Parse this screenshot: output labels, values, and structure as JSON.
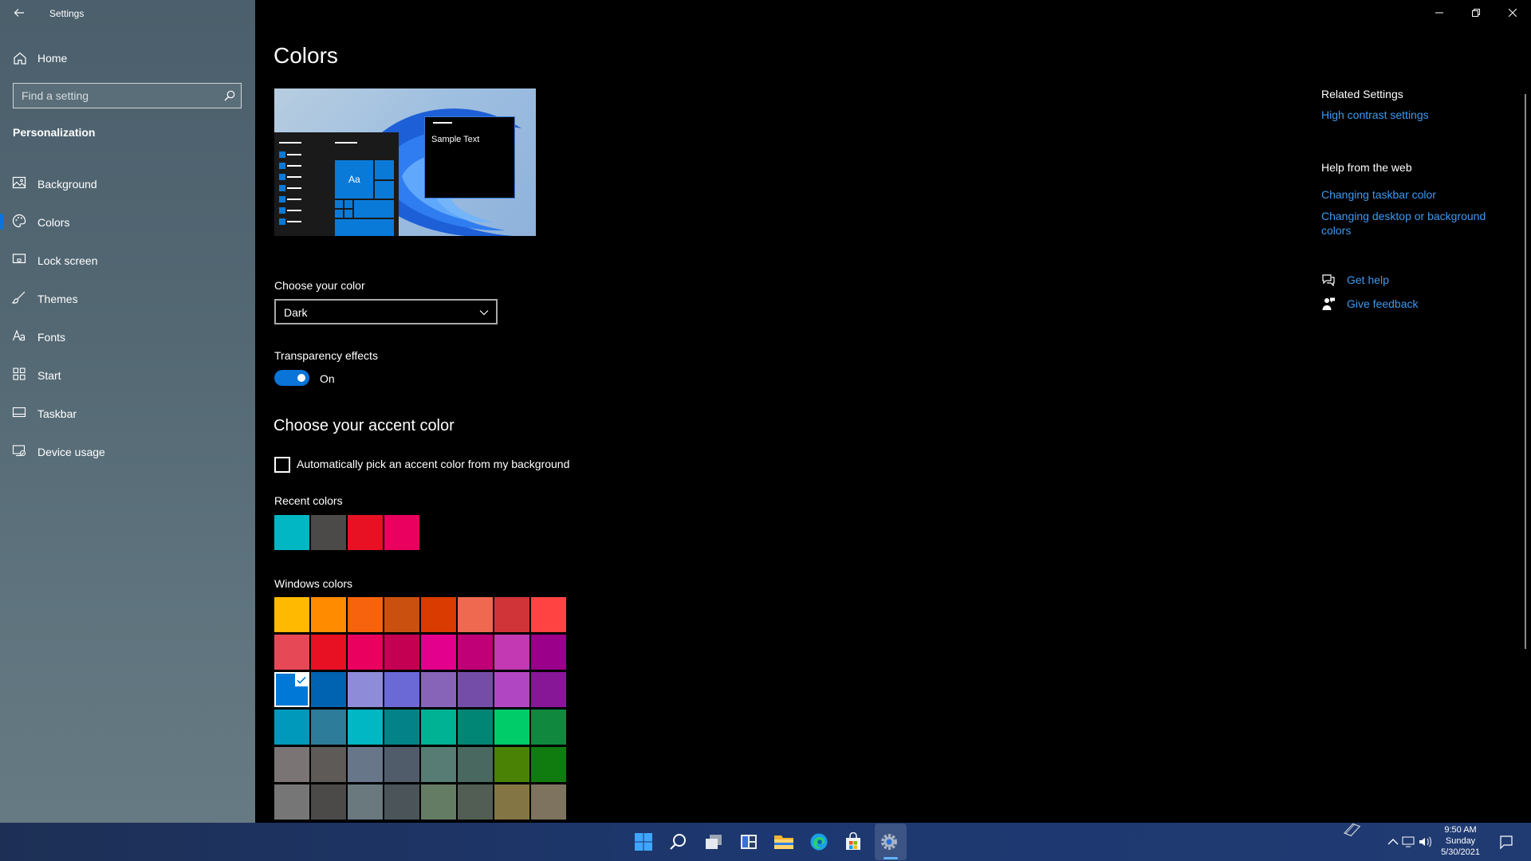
{
  "window": {
    "title": "Settings"
  },
  "sidebar": {
    "home": "Home",
    "search_placeholder": "Find a setting",
    "section": "Personalization",
    "items": [
      {
        "label": "Background",
        "icon": "image-icon"
      },
      {
        "label": "Colors",
        "icon": "palette-icon",
        "active": true
      },
      {
        "label": "Lock screen",
        "icon": "monitor-icon"
      },
      {
        "label": "Themes",
        "icon": "brush-icon"
      },
      {
        "label": "Fonts",
        "icon": "font-icon"
      },
      {
        "label": "Start",
        "icon": "grid-icon"
      },
      {
        "label": "Taskbar",
        "icon": "taskbar-icon"
      },
      {
        "label": "Device usage",
        "icon": "device-icon"
      }
    ]
  },
  "main": {
    "title": "Colors",
    "preview_sample_text": "Sample Text",
    "preview_tile_label": "Aa",
    "choose_color_label": "Choose your color",
    "choose_color_value": "Dark",
    "transparency_label": "Transparency effects",
    "transparency_state": "On",
    "accent_heading": "Choose your accent color",
    "auto_accent_label": "Automatically pick an accent color from my background",
    "recent_colors_label": "Recent colors",
    "recent_colors": [
      "#00b7c3",
      "#4c4a48",
      "#e81123",
      "#ea005e"
    ],
    "windows_colors_label": "Windows colors",
    "windows_colors": [
      [
        "#ffb900",
        "#ff8c00",
        "#f7630c",
        "#ca5010",
        "#da3b01",
        "#ef6950",
        "#d13438",
        "#ff4343"
      ],
      [
        "#e74856",
        "#e81123",
        "#ea005e",
        "#c30052",
        "#e3008c",
        "#bf0077",
        "#c239b3",
        "#9a0089"
      ],
      [
        "#0078d7",
        "#0063b1",
        "#8e8cd8",
        "#6b69d6",
        "#8764b8",
        "#744da9",
        "#b146c2",
        "#881798"
      ],
      [
        "#0099bc",
        "#2d7d9a",
        "#00b7c3",
        "#038387",
        "#00b294",
        "#018574",
        "#00cc6a",
        "#10893e"
      ],
      [
        "#7a7574",
        "#5d5a58",
        "#68768a",
        "#515c6b",
        "#567c73",
        "#486860",
        "#498205",
        "#107c10"
      ],
      [
        "#767676",
        "#4c4a48",
        "#69797e",
        "#4a5459",
        "#647c64",
        "#525e54",
        "#847545",
        "#7e735f"
      ]
    ],
    "selected_color": "#0078d7"
  },
  "related": {
    "heading": "Related Settings",
    "links": [
      "High contrast settings"
    ],
    "web_heading": "Help from the web",
    "web_links": [
      "Changing taskbar color",
      "Changing desktop or background colors"
    ],
    "get_help": "Get help",
    "give_feedback": "Give feedback"
  },
  "taskbar": {
    "time": "9:50 AM",
    "day": "Sunday",
    "date": "5/30/2021"
  }
}
